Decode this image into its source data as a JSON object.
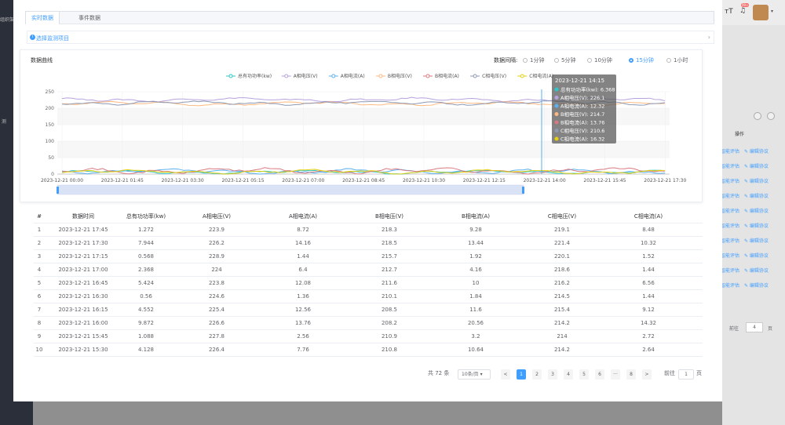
{
  "background": {
    "sidebar_text": "组织架构",
    "sidebar_text2": "测",
    "right_ops": [
      "智能评估",
      "编辑协议"
    ],
    "op_header": "操作",
    "goto_label": "前往",
    "goto_value": "4",
    "page_unit": "页",
    "badge": "99+"
  },
  "tabs": [
    "实时数据",
    "事件数据"
  ],
  "collapse": {
    "label": "选择监测项目"
  },
  "card": {
    "title": "数据曲线",
    "interval_label": "数据间隔:",
    "intervals": [
      "1分钟",
      "5分钟",
      "10分钟",
      "15分钟",
      "1小时"
    ],
    "selected_interval": "15分钟"
  },
  "chart_data": {
    "type": "line",
    "legend": [
      "总有功功率(kw)",
      "A相电压(V)",
      "A相电流(A)",
      "B相电压(V)",
      "B相电流(A)",
      "C相电压(V)",
      "C相电流(A)"
    ],
    "colors": [
      "#2ec7c9",
      "#b6a2de",
      "#5ab1ef",
      "#ffb980",
      "#d87a80",
      "#8d98b3",
      "#e5cf0d"
    ],
    "y_ticks": [
      "0",
      "50",
      "100",
      "150",
      "200",
      "250"
    ],
    "ylim": [
      0,
      250
    ],
    "x_ticks": [
      "2023-12-21 00:00",
      "2023-12-21 01:45",
      "2023-12-21 03:30",
      "2023-12-21 05:15",
      "2023-12-21 07:00",
      "2023-12-21 08:45",
      "2023-12-21 10:30",
      "2023-12-21 12:15",
      "2023-12-21 14:00",
      "2023-12-21 15:45",
      "2023-12-21 17:30"
    ],
    "series_mean": [
      6,
      226,
      8,
      214,
      10,
      216,
      7
    ],
    "tooltip": {
      "time": "2023-12-21 14:15",
      "rows": [
        {
          "label": "总有功功率(kw): 6.368"
        },
        {
          "label": "A相电压(V): 226.1"
        },
        {
          "label": "A相电流(A): 12.32"
        },
        {
          "label": "B相电压(V): 214.7"
        },
        {
          "label": "B相电流(A): 13.76"
        },
        {
          "label": "C相电压(V): 210.6"
        },
        {
          "label": "C相电流(A): 16.32"
        }
      ]
    }
  },
  "table": {
    "headers": [
      "#",
      "数据时间",
      "总有功功率(kw)",
      "A相电压(V)",
      "A相电流(A)",
      "B相电压(V)",
      "B相电流(A)",
      "C相电压(V)",
      "C相电流(A)"
    ],
    "rows": [
      [
        "1",
        "2023-12-21 17:45",
        "1.272",
        "223.9",
        "8.72",
        "218.3",
        "9.28",
        "219.1",
        "8.48"
      ],
      [
        "2",
        "2023-12-21 17:30",
        "7.944",
        "226.2",
        "14.16",
        "218.5",
        "13.44",
        "221.4",
        "10.32"
      ],
      [
        "3",
        "2023-12-21 17:15",
        "0.568",
        "228.9",
        "1.44",
        "215.7",
        "1.92",
        "220.1",
        "1.52"
      ],
      [
        "4",
        "2023-12-21 17:00",
        "2.368",
        "224",
        "6.4",
        "212.7",
        "4.16",
        "218.6",
        "1.44"
      ],
      [
        "5",
        "2023-12-21 16:45",
        "5.424",
        "223.8",
        "12.08",
        "211.6",
        "10",
        "216.2",
        "6.56"
      ],
      [
        "6",
        "2023-12-21 16:30",
        "0.56",
        "224.6",
        "1.36",
        "210.1",
        "1.84",
        "214.5",
        "1.44"
      ],
      [
        "7",
        "2023-12-21 16:15",
        "4.552",
        "225.4",
        "12.56",
        "208.5",
        "11.6",
        "215.4",
        "9.12"
      ],
      [
        "8",
        "2023-12-21 16:00",
        "9.872",
        "226.6",
        "13.76",
        "208.2",
        "20.56",
        "214.2",
        "14.32"
      ],
      [
        "9",
        "2023-12-21 15:45",
        "1.088",
        "227.8",
        "2.56",
        "210.9",
        "3.2",
        "214",
        "2.72"
      ],
      [
        "10",
        "2023-12-21 15:30",
        "4.128",
        "226.4",
        "7.76",
        "210.8",
        "10.64",
        "214.2",
        "2.64"
      ]
    ]
  },
  "pagination": {
    "total": "共 72 条",
    "page_size": "10条/页",
    "pages": [
      "1",
      "2",
      "3",
      "4",
      "5",
      "6",
      "···",
      "8"
    ],
    "current": "1",
    "prev": "<",
    "next": ">",
    "goto_label": "前往",
    "goto_value": "1",
    "page_unit": "页"
  }
}
